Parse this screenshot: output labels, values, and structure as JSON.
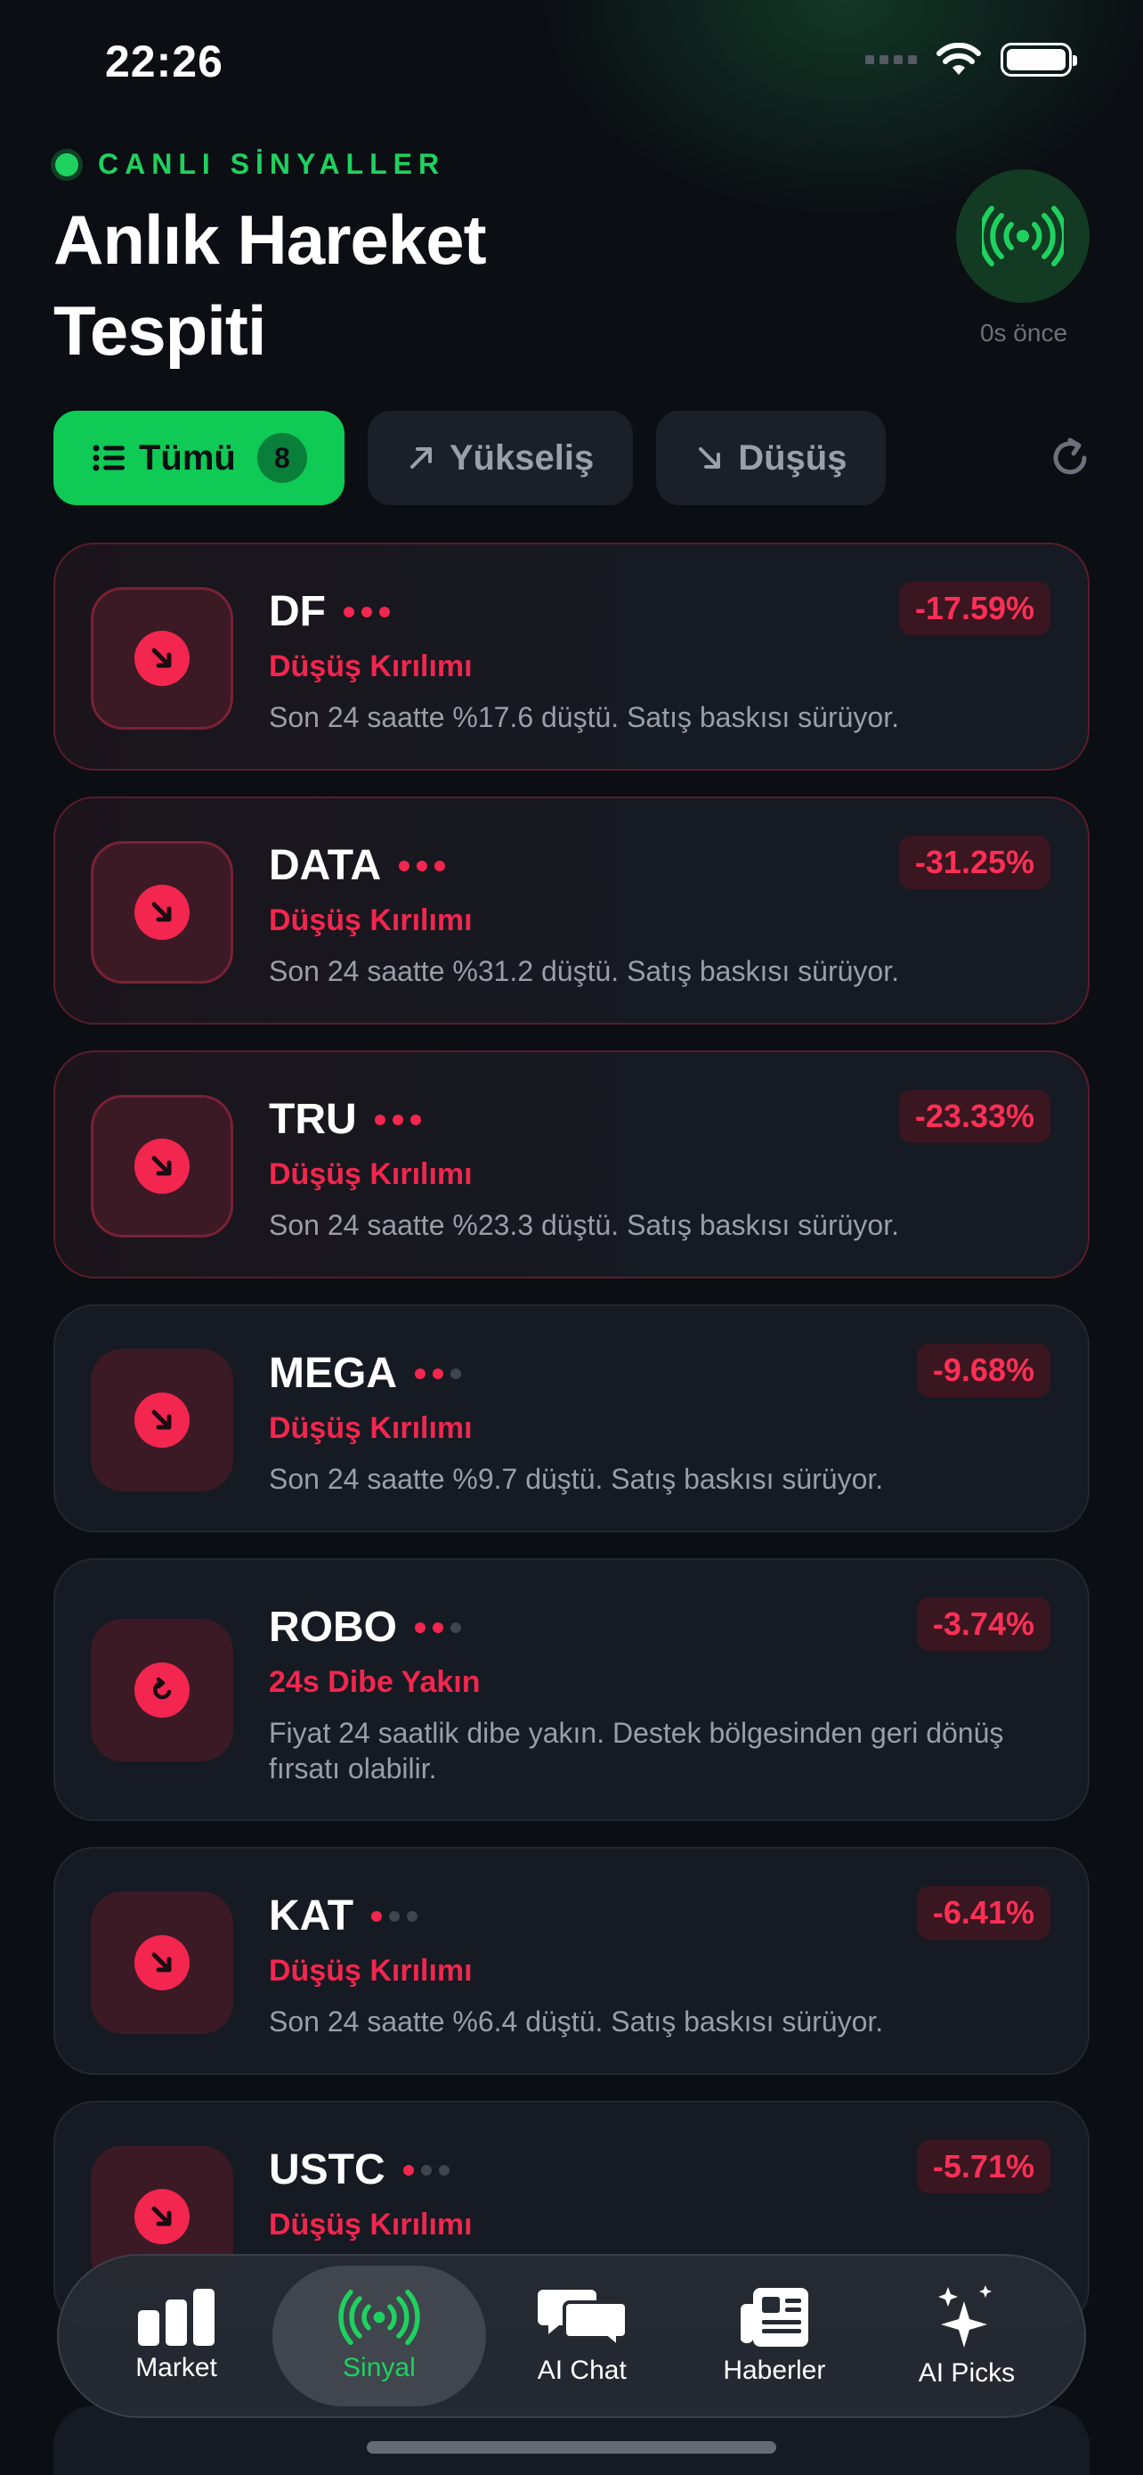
{
  "status_bar": {
    "time": "22:26"
  },
  "header": {
    "live_label": "CANLI SİNYALLER",
    "title": "Anlık Hareket Tespiti",
    "last_update": "0s önce"
  },
  "filters": {
    "all_label": "Tümü",
    "all_count": "8",
    "up_label": "Yükseliş",
    "down_label": "Düşüş"
  },
  "signals": [
    {
      "symbol": "DF",
      "pct": "-17.59%",
      "type": "Düşüş Kırılımı",
      "desc": "Son 24 saatte %17.6 düştü. Satış baskısı sürüyor.",
      "strength": 3
    },
    {
      "symbol": "DATA",
      "pct": "-31.25%",
      "type": "Düşüş Kırılımı",
      "desc": "Son 24 saatte %31.2 düştü. Satış baskısı sürüyor.",
      "strength": 3
    },
    {
      "symbol": "TRU",
      "pct": "-23.33%",
      "type": "Düşüş Kırılımı",
      "desc": "Son 24 saatte %23.3 düştü. Satış baskısı sürüyor.",
      "strength": 3
    },
    {
      "symbol": "MEGA",
      "pct": "-9.68%",
      "type": "Düşüş Kırılımı",
      "desc": "Son 24 saatte %9.7 düştü. Satış baskısı sürüyor.",
      "strength": 2
    },
    {
      "symbol": "ROBO",
      "pct": "-3.74%",
      "type": "24s Dibe Yakın",
      "desc": "Fiyat 24 saatlik dibe yakın. Destek bölgesinden geri dönüş fırsatı olabilir.",
      "strength": 2
    },
    {
      "symbol": "KAT",
      "pct": "-6.41%",
      "type": "Düşüş Kırılımı",
      "desc": "Son 24 saatte %6.4 düştü. Satış baskısı sürüyor.",
      "strength": 1
    },
    {
      "symbol": "USTC",
      "pct": "-5.71%",
      "type": "Düşüş Kırılımı",
      "desc": "",
      "strength": 1
    }
  ],
  "tabbar": {
    "market": "Market",
    "sinyal": "Sinyal",
    "ai_chat": "AI Chat",
    "haberler": "Haberler",
    "ai_picks": "AI Picks"
  },
  "colors": {
    "accent": "#1fd15f",
    "danger": "#f2264e",
    "background": "#0b0e13"
  }
}
